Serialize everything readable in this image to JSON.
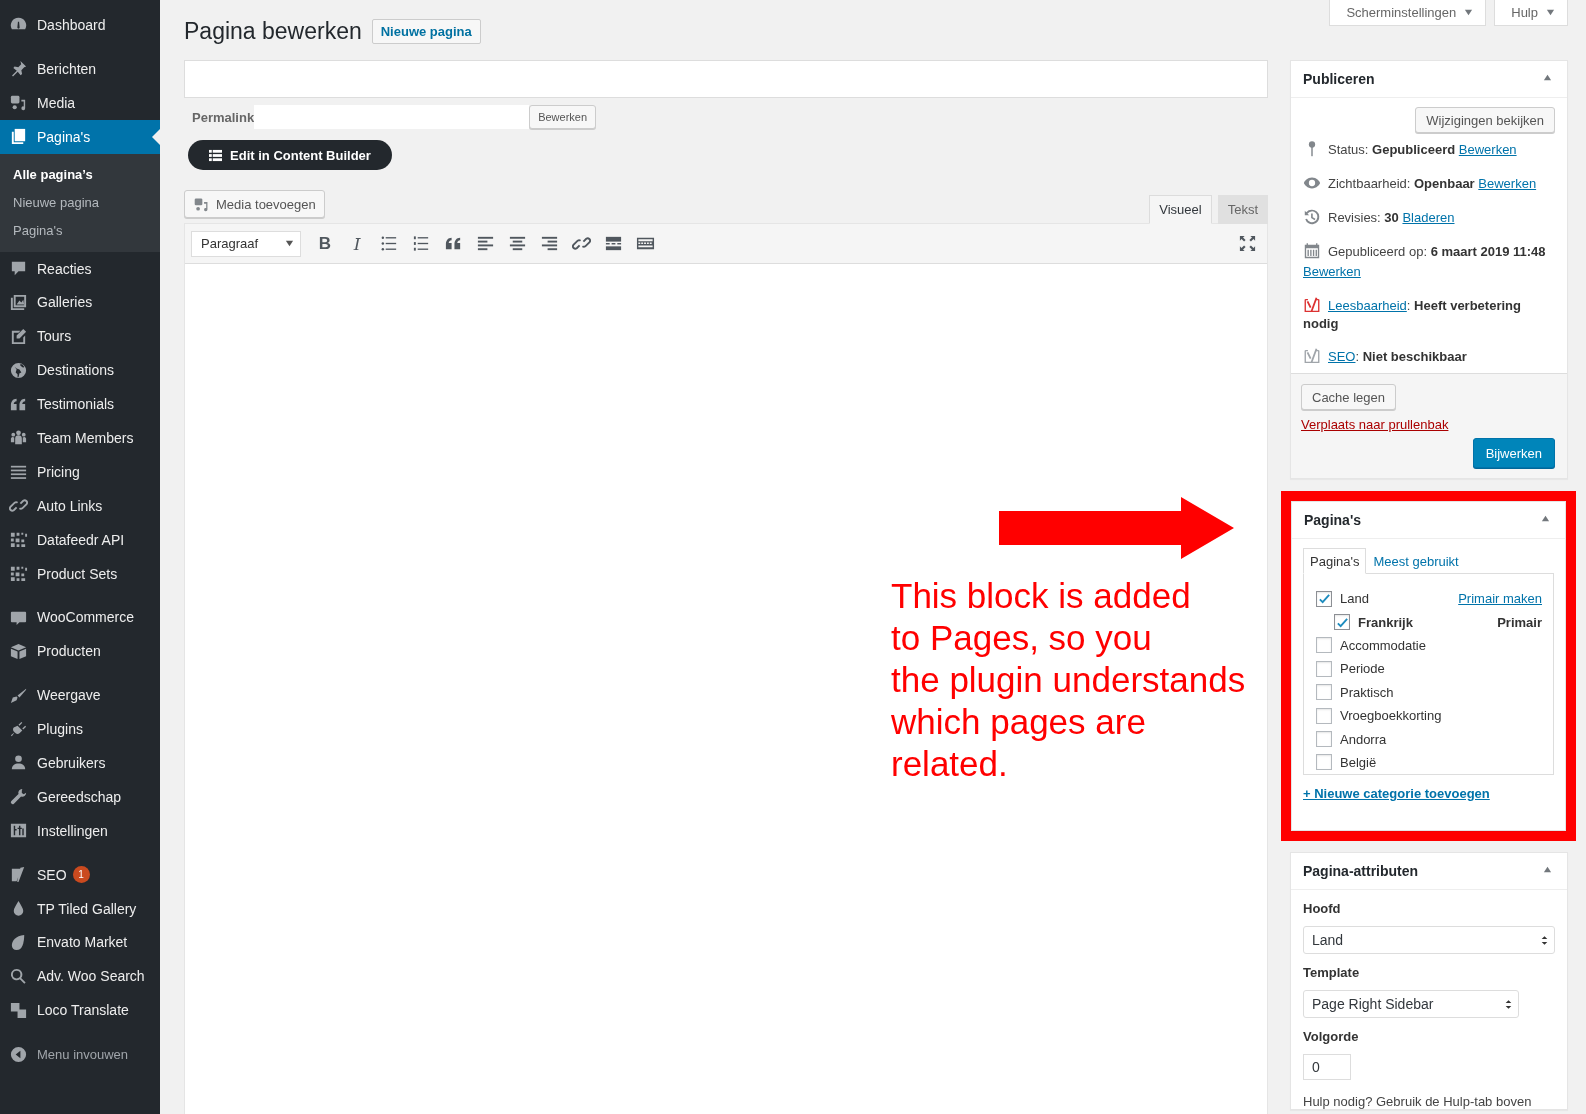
{
  "sidebar": {
    "groups": [
      {
        "items": [
          {
            "label": "Dashboard",
            "selected": false
          }
        ]
      },
      {
        "items": [
          {
            "label": "Berichten",
            "selected": false
          },
          {
            "label": "Media",
            "selected": false
          },
          {
            "label": "Pagina's",
            "selected": true,
            "children": [
              {
                "label": "Alle pagina’s",
                "selected": true
              },
              {
                "label": "Nieuwe pagina",
                "selected": false
              },
              {
                "label": "Pagina's",
                "selected": false
              }
            ]
          },
          {
            "label": "Reacties",
            "selected": false
          },
          {
            "label": "Galleries",
            "selected": false
          },
          {
            "label": "Tours",
            "selected": false
          },
          {
            "label": "Destinations",
            "selected": false
          },
          {
            "label": "Testimonials",
            "selected": false
          },
          {
            "label": "Team Members",
            "selected": false
          },
          {
            "label": "Pricing",
            "selected": false
          },
          {
            "label": "Auto Links",
            "selected": false
          },
          {
            "label": "Datafeedr API",
            "selected": false
          },
          {
            "label": "Product Sets",
            "selected": false
          }
        ]
      },
      {
        "items": [
          {
            "label": "WooCommerce",
            "selected": false
          },
          {
            "label": "Producten",
            "selected": false
          }
        ]
      },
      {
        "items": [
          {
            "label": "Weergave",
            "selected": false
          },
          {
            "label": "Plugins",
            "selected": false
          },
          {
            "label": "Gebruikers",
            "selected": false
          },
          {
            "label": "Gereedschap",
            "selected": false
          },
          {
            "label": "Instellingen",
            "selected": false
          }
        ]
      },
      {
        "items": [
          {
            "label": "SEO",
            "selected": false,
            "badge": "1"
          },
          {
            "label": "TP Tiled Gallery",
            "selected": false
          },
          {
            "label": "Envato Market",
            "selected": false
          },
          {
            "label": "Adv. Woo Search",
            "selected": false
          },
          {
            "label": "Loco Translate",
            "selected": false
          }
        ]
      }
    ],
    "collapse": "Menu invouwen"
  },
  "header": {
    "title": "Pagina bewerken",
    "add_new": "Nieuwe pagina"
  },
  "screen_tabs": [
    {
      "label": "Scherminstellingen"
    },
    {
      "label": "Hulp"
    }
  ],
  "editor": {
    "permalink_label": "Permalink",
    "permalink_button": "Bewerken",
    "builder_button": "Edit in Content Builder",
    "media_button": "Media toevoegen",
    "tabs": [
      {
        "label": "Visueel",
        "selected": true
      },
      {
        "label": "Tekst",
        "selected": false
      }
    ],
    "toolbar": {
      "format": "Paragraaf",
      "text_buttons": [
        {
          "kind": "bold",
          "label": "B"
        },
        {
          "kind": "italic",
          "label": "I"
        }
      ]
    }
  },
  "annotation": {
    "lines": [
      "This block is added",
      "to Pages, so you",
      "the plugin understands",
      "which pages are",
      "related."
    ]
  },
  "publish": {
    "title": "Publiceren",
    "preview_button": "Wijzigingen bekijken",
    "rows": [
      {
        "kind": "status",
        "text": "Status: **Gepubliceerd**",
        "link": "Bewerken"
      },
      {
        "kind": "visibility",
        "text": "Zichtbaarheid: **Openbaar**",
        "link": "Bewerken"
      },
      {
        "kind": "revisions",
        "text": "Revisies: **30**",
        "link": "Bladeren"
      },
      {
        "kind": "date",
        "text": "Gepubliceerd op: **6 maart 2019 11:48**",
        "link": "Bewerken"
      },
      {
        "kind": "score",
        "color": "#dc3232",
        "link": "Leesbaarheid",
        "text": ": **Heeft verbetering nodig**"
      },
      {
        "kind": "score",
        "color": "#a0a5aa",
        "link": "SEO",
        "text": ": **Niet beschikbaar**"
      }
    ],
    "cache_button": "Cache legen",
    "trash_link": "Verplaats naar prullenbak",
    "update_button": "Bijwerken"
  },
  "categories": {
    "title": "Pagina's",
    "highlighted": true,
    "tabs": [
      {
        "label": "Pagina's",
        "selected": true
      },
      {
        "label": "Meest gebruikt",
        "selected": false
      }
    ],
    "items": [
      {
        "label": "Land",
        "checked": true,
        "primary": false,
        "primary_link": "Primair maken",
        "children": [
          {
            "label": "Frankrijk",
            "checked": true,
            "primary": true,
            "primary_label": "Primair"
          }
        ]
      },
      {
        "label": "Accommodatie",
        "checked": false,
        "primary": false
      },
      {
        "label": "Periode",
        "checked": false,
        "primary": false
      },
      {
        "label": "Praktisch",
        "checked": false,
        "primary": false
      },
      {
        "label": "Vroegboekkorting",
        "checked": false,
        "primary": false
      },
      {
        "label": "Andorra",
        "checked": false,
        "primary": false
      },
      {
        "label": "België",
        "checked": false,
        "primary": false
      }
    ],
    "add_link": "+ Nieuwe categorie toevoegen"
  },
  "attributes": {
    "title": "Pagina-attributen",
    "fields": [
      {
        "kind": "select",
        "label": "Hoofd",
        "value": "Land"
      },
      {
        "kind": "select",
        "label": "Template",
        "value": "Page Right Sidebar"
      },
      {
        "kind": "number",
        "label": "Volgorde",
        "value": "0"
      }
    ],
    "help": "Hulp nodig? Gebruik de Hulp-tab boven"
  }
}
